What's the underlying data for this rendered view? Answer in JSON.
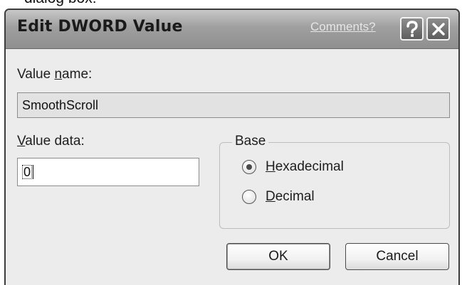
{
  "caption": "dialog box:",
  "dialog": {
    "title": "Edit DWORD Value",
    "comments_link": "Comments?",
    "value_name_label_pre": "Value ",
    "value_name_label_key": "n",
    "value_name_label_post": "ame:",
    "value_name": "SmoothScroll",
    "value_data_label_key": "V",
    "value_data_label_post": "alue data:",
    "value_data": "0",
    "base_label": "Base",
    "base_options": [
      {
        "key": "H",
        "rest": "exadecimal",
        "selected": true
      },
      {
        "key": "D",
        "rest": "ecimal",
        "selected": false
      }
    ],
    "ok_label": "OK",
    "cancel_label": "Cancel"
  }
}
